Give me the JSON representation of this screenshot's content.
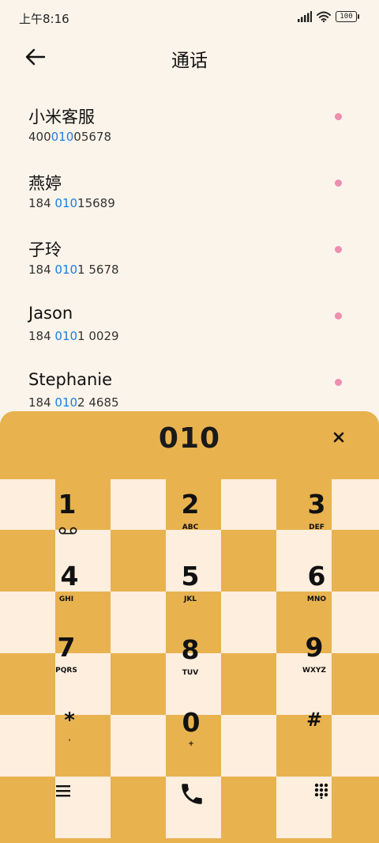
{
  "status_bar": {
    "time": "上午8:16",
    "battery": "100"
  },
  "header": {
    "title": "通话"
  },
  "contacts": [
    {
      "name": "小米客服",
      "number_pre": "400",
      "number_match": "010",
      "number_post": "05678"
    },
    {
      "name": "燕婷",
      "number_pre": "184 ",
      "number_match": "010",
      "number_post": "15689"
    },
    {
      "name": "子玲",
      "number_pre": "184 ",
      "number_match": "010",
      "number_post": "1 5678"
    },
    {
      "name": "Jason",
      "number_pre": "184 ",
      "number_match": "010",
      "number_post": "1 0029"
    },
    {
      "name": "Stephanie",
      "number_pre": "184 ",
      "number_match": "010",
      "number_post": "2 4685"
    }
  ],
  "dialer": {
    "input": "010",
    "keys": [
      {
        "digit": "1",
        "letters": ""
      },
      {
        "digit": "2",
        "letters": "ABC"
      },
      {
        "digit": "3",
        "letters": "DEF"
      },
      {
        "digit": "4",
        "letters": "GHI"
      },
      {
        "digit": "5",
        "letters": "JKL"
      },
      {
        "digit": "6",
        "letters": "MNO"
      },
      {
        "digit": "7",
        "letters": "PQRS"
      },
      {
        "digit": "8",
        "letters": "TUV"
      },
      {
        "digit": "9",
        "letters": "WXYZ"
      },
      {
        "digit": "*",
        "letters": "'"
      },
      {
        "digit": "0",
        "letters": "+"
      },
      {
        "digit": "#",
        "letters": ""
      }
    ]
  },
  "icons": {
    "back": "arrow-left-icon",
    "clear": "close-icon",
    "menu": "menu-icon",
    "call": "phone-icon",
    "keypad": "keypad-icon",
    "voicemail": "voicemail-icon"
  },
  "colors": {
    "background": "#fbf4ea",
    "panel": "#e8b24f",
    "cell_light": "#fdeedd",
    "match": "#1a7ee0",
    "dot": "#ec8fb0"
  }
}
